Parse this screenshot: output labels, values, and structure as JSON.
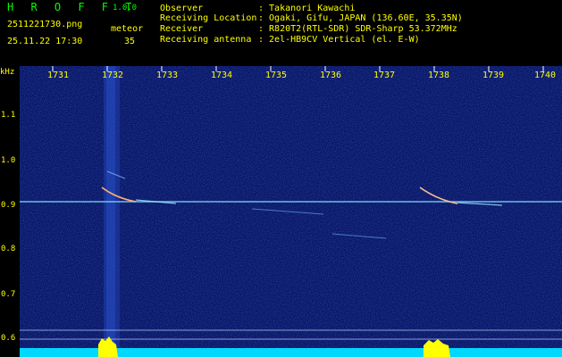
{
  "header": {
    "app_name": "H R O F F T",
    "version": "1.0.0",
    "filename": "2511221730.png",
    "datetime": "25.11.22 17:30",
    "meteor_label": "meteor",
    "meteor_count": "35"
  },
  "info": [
    {
      "label": "Observer",
      "value": ": Takanori Kawachi"
    },
    {
      "label": "Receiving Location",
      "value": ": Ogaki, Gifu, JAPAN (136.60E, 35.35N)"
    },
    {
      "label": "Receiver",
      "value": ": R820T2(RTL-SDR) SDR-Sharp 53.372MHz"
    },
    {
      "label": "Receiving antenna",
      "value": ": 2el-HB9CV Vertical (el. E-W)"
    }
  ],
  "axis": {
    "unit": "kHz",
    "y_ticks": [
      "1.1",
      "1.0",
      "0.9",
      "0.8",
      "0.7",
      "0.6"
    ],
    "x_ticks": [
      "1731",
      "1732",
      "1733",
      "1734",
      "1735",
      "1736",
      "1737",
      "1738",
      "1739",
      "1740"
    ]
  },
  "colors": {
    "text": "#ffff00",
    "title": "#00ff00",
    "background": "#061260",
    "carrier": "#7fd8ff"
  }
}
